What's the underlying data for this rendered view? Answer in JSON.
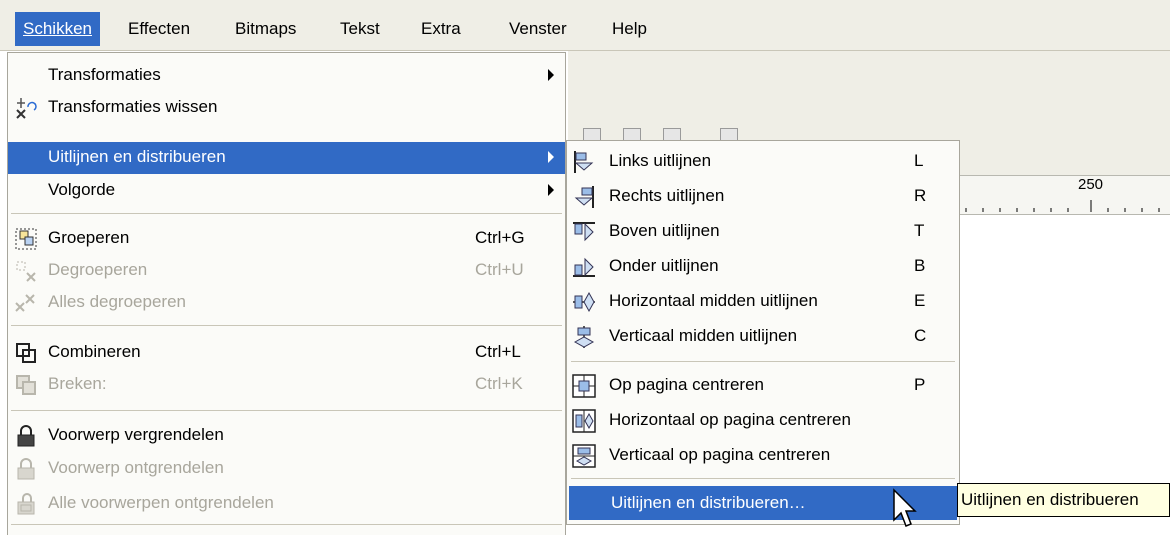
{
  "menubar": {
    "items": [
      {
        "label": "Schikken"
      },
      {
        "label": "Effecten"
      },
      {
        "label": "Bitmaps"
      },
      {
        "label": "Tekst"
      },
      {
        "label": "Extra"
      },
      {
        "label": "Venster"
      },
      {
        "label": "Help"
      }
    ]
  },
  "ruler": {
    "value": "250"
  },
  "menu": {
    "items": [
      {
        "label": "Transformaties",
        "icon": "none",
        "shortcut": "",
        "enabled": true,
        "submenu": true
      },
      {
        "label": "Transformaties wissen",
        "icon": "clear-transformations-icon",
        "shortcut": "",
        "enabled": true,
        "submenu": false
      },
      {
        "label": "Uitlijnen en distribueren",
        "icon": "none",
        "shortcut": "",
        "enabled": true,
        "submenu": true,
        "highlighted": true
      },
      {
        "label": "Volgorde",
        "icon": "none",
        "shortcut": "",
        "enabled": true,
        "submenu": true
      },
      {
        "label": "Groeperen",
        "icon": "group-icon",
        "shortcut": "Ctrl+G",
        "enabled": true
      },
      {
        "label": "Degroeperen",
        "icon": "ungroup-icon",
        "shortcut": "Ctrl+U",
        "enabled": false
      },
      {
        "label": "Alles degroeperen",
        "icon": "ungroup-all-icon",
        "shortcut": "",
        "enabled": false
      },
      {
        "label": "Combineren",
        "icon": "combine-icon",
        "shortcut": "Ctrl+L",
        "enabled": true
      },
      {
        "label": "Breken:",
        "icon": "break-apart-icon",
        "shortcut": "Ctrl+K",
        "enabled": false
      },
      {
        "label": "Voorwerp vergrendelen",
        "icon": "lock-icon",
        "shortcut": "",
        "enabled": true
      },
      {
        "label": "Voorwerp ontgrendelen",
        "icon": "unlock-icon",
        "shortcut": "",
        "enabled": false
      },
      {
        "label": "Alle voorwerpen ontgrendelen",
        "icon": "unlock-all-icon",
        "shortcut": "",
        "enabled": false
      }
    ]
  },
  "submenu": {
    "items": [
      {
        "label": "Links uitlijnen",
        "key": "L",
        "icon": "align-left-icon"
      },
      {
        "label": "Rechts uitlijnen",
        "key": "R",
        "icon": "align-right-icon"
      },
      {
        "label": "Boven uitlijnen",
        "key": "T",
        "icon": "align-top-icon"
      },
      {
        "label": "Onder uitlijnen",
        "key": "B",
        "icon": "align-bottom-icon"
      },
      {
        "label": "Horizontaal midden uitlijnen",
        "key": "E",
        "icon": "align-horizontal-center-icon"
      },
      {
        "label": "Verticaal midden uitlijnen",
        "key": "C",
        "icon": "align-vertical-center-icon"
      },
      {
        "label": "Op pagina centreren",
        "key": "P",
        "icon": "center-on-page-icon"
      },
      {
        "label": "Horizontaal op pagina centreren",
        "key": "",
        "icon": "center-horizontal-page-icon"
      },
      {
        "label": "Verticaal op pagina centreren",
        "key": "",
        "icon": "center-vertical-page-icon"
      },
      {
        "label": "Uitlijnen en distribueren…",
        "key": "",
        "icon": "none",
        "highlighted": true
      }
    ]
  },
  "tooltip": {
    "text": "Uitlijnen en distribueren"
  },
  "colors": {
    "highlight": "#316ac5",
    "menu_bg": "#fbfbf8",
    "disabled": "#a8a69c",
    "tooltip_bg": "#ffffe1"
  }
}
